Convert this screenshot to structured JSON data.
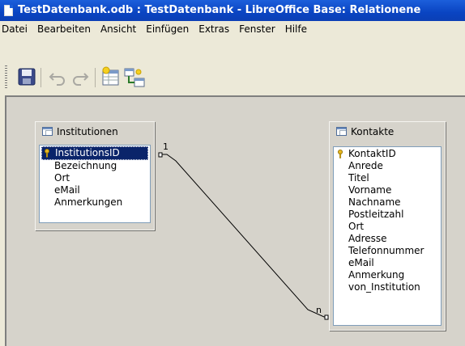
{
  "window": {
    "title": "TestDatenbank.odb : TestDatenbank - LibreOffice Base: Relationene"
  },
  "menu": {
    "items": [
      {
        "label": "Datei"
      },
      {
        "label": "Bearbeiten"
      },
      {
        "label": "Ansicht"
      },
      {
        "label": "Einfügen"
      },
      {
        "label": "Extras"
      },
      {
        "label": "Fenster"
      },
      {
        "label": "Hilfe"
      }
    ]
  },
  "toolbar": {
    "icons": [
      "save-icon",
      "undo-icon",
      "redo-icon",
      "add-table-icon",
      "new-relation-icon"
    ]
  },
  "tables": {
    "institutionen": {
      "name": "Institutionen",
      "fields": [
        "InstitutionsID",
        "Bezeichnung",
        "Ort",
        "eMail",
        "Anmerkungen"
      ],
      "primary_key": "InstitutionsID"
    },
    "kontakte": {
      "name": "Kontakte",
      "fields": [
        "KontaktID",
        "Anrede",
        "Titel",
        "Vorname",
        "Nachname",
        "Postleitzahl",
        "Ort",
        "Adresse",
        "Telefonnummer",
        "eMail",
        "Anmerkung",
        "von_Institution"
      ],
      "primary_key": "KontaktID"
    }
  },
  "relation": {
    "from_label": "1",
    "to_label": "n"
  },
  "colors": {
    "titlebar": "#0a44c2",
    "selection": "#0a246a",
    "canvas": "#d6d3cb",
    "key": "#e8b820"
  }
}
